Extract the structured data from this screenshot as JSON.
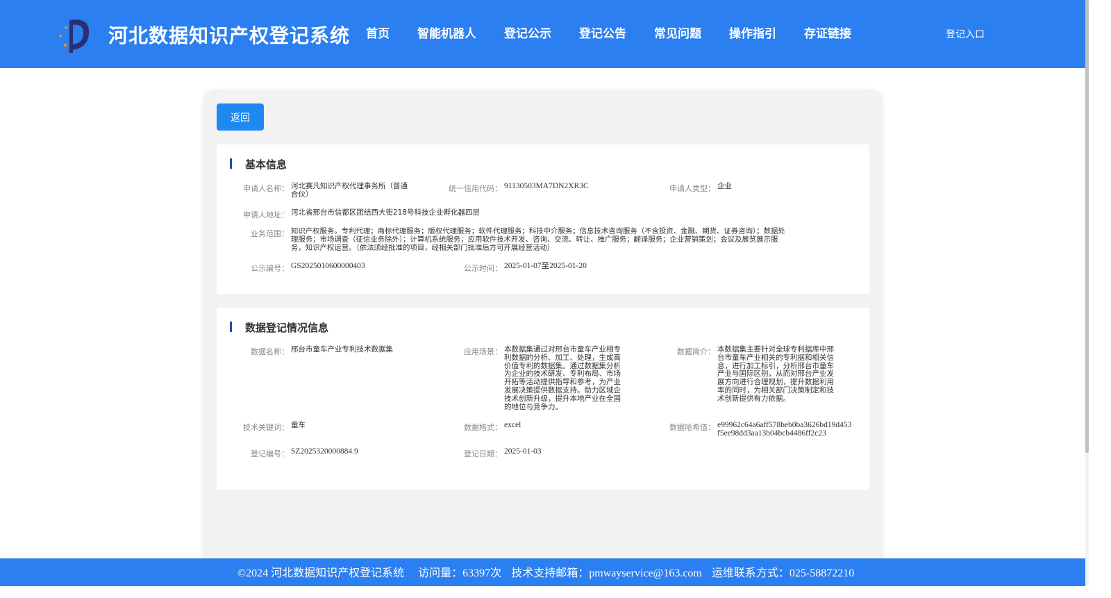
{
  "header": {
    "site_title": "河北数据知识产权登记系统",
    "nav": [
      "首页",
      "智能机器人",
      "登记公示",
      "登记公告",
      "常见问题",
      "操作指引",
      "存证链接"
    ],
    "login": "登记入口",
    "bg_color": "#2b7ff0"
  },
  "back_label": "返回",
  "basic": {
    "title": "基本信息",
    "applicant_name_label": "申请人名称：",
    "applicant_name_line1": "河北赛凡知识产权代理事务所（普通",
    "applicant_name_line2": "合伙）",
    "credit_code_label": "统一信用代码：",
    "credit_code": "91130503MA7DN2XR3C",
    "applicant_type_label": "申请人类型：",
    "applicant_type": "企业",
    "address_label": "申请人地址：",
    "address": "河北省邢台市信都区团结西大街218号科技企业孵化器四层",
    "scope_label": "业务范围：",
    "scope_line1": "知识产权服务。专利代理；商标代理服务；版权代理服务；软件代理服务；科技中介服务；信息技术咨询服务（不含投资、金融、期货、证券咨询）；数据处",
    "scope_line2": "理服务；市场调查（征信业务除外）；计算机系统服务；应用软件技术开发、咨询、交流、转让、推广服务；翻译服务；企业营销策划；会议及展览展示服",
    "scope_line3": "务，知识产权运营。（依法须经批准的项目，经相关部门批准后方可开展经营活动）",
    "pub_no_label": "公示编号：",
    "pub_no": "GS2025010600000403",
    "pub_time_label": "公示时间：",
    "pub_time": "2025-01-07至2025-01-20"
  },
  "data_reg": {
    "title": "数据登记情况信息",
    "data_name_label": "数据名称：",
    "data_name": "邢台市童车产业专利技术数据集",
    "scenario_label": "应用场景：",
    "scenario_lines": [
      "本数据集通过对邢台市童车产业相专",
      "利数据的分析、加工、处理，生成高",
      "价值专利的数据集。通过数据集分析",
      "为企业的技术研发、专利布局、市场",
      "开拓等活动提供指导和参考，为产业",
      "发展决策提供数据支持。助力区域企",
      "技术创新升级，提升本地产业在全国",
      "的地位与竞争力。"
    ],
    "intro_label": "数据简介：",
    "intro_lines": [
      "本数据集主要针对全球专利据库中邢",
      "台市童车产业相关的专利据和相关信",
      "息，进行加工标引，分析邢台市童车",
      "产业与国际区别，从而对邢台产业发",
      "展方向进行合理规划，提升数据利用",
      "率的同时，为相关部门决策制定和技",
      "术创新提供有力依据。"
    ],
    "keywords_label": "技术关键词：",
    "keywords": "童车",
    "format_label": "数据格式：",
    "format": "excel",
    "hash_label": "数据哈希值：",
    "hash_line1": "e99962c64a6aff578beb0ba3626bd19d453",
    "hash_line2": "f5ee98dd3aa13b04bcb4486ff2c23",
    "reg_no_label": "登记编号：",
    "reg_no": "SZ2025320000884.9",
    "reg_date_label": "登记日期：",
    "reg_date": "2025-01-03"
  },
  "footer": {
    "copyright": "©2024 河北数据知识产权登记系统",
    "visits": "访问量：63397次",
    "email": "技术支持邮箱：pmwayservice@163.com",
    "phone": "运维联系方式：025-58872210"
  }
}
